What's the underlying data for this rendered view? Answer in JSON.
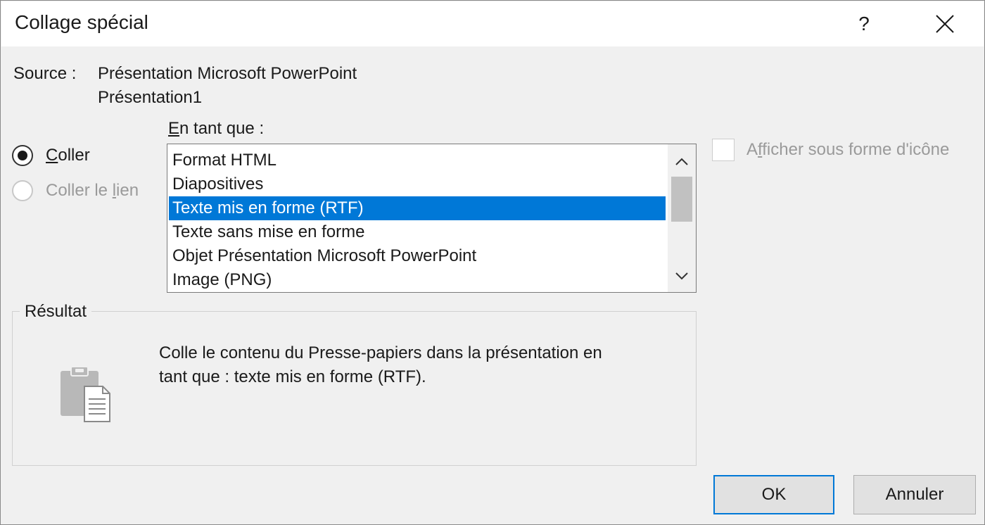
{
  "window": {
    "title": "Collage spécial",
    "help_label": "?"
  },
  "source": {
    "label": "Source :",
    "line1": "Présentation Microsoft PowerPoint",
    "line2": "Présentation1"
  },
  "paste_options": {
    "paste": {
      "accel": "C",
      "rest": "oller",
      "checked": true
    },
    "paste_link": {
      "pre": "Coller le ",
      "accel": "l",
      "rest": "ien",
      "checked": false,
      "disabled": true
    }
  },
  "as_type": {
    "accel": "E",
    "rest": "n tant que :",
    "items": [
      {
        "label": "Format HTML",
        "selected": false
      },
      {
        "label": "Diapositives",
        "selected": false
      },
      {
        "label": "Texte mis en forme (RTF)",
        "selected": true
      },
      {
        "label": "Texte sans mise en forme",
        "selected": false
      },
      {
        "label": "Objet Présentation Microsoft PowerPoint",
        "selected": false
      },
      {
        "label": "Image (PNG)",
        "selected": false
      }
    ]
  },
  "display_as_icon": {
    "pre": "A",
    "accel": "f",
    "rest": "ficher sous forme d'icône",
    "checked": false,
    "disabled": true
  },
  "result": {
    "legend": "Résultat",
    "line1": "Colle le contenu du Presse-papiers dans la présentation en",
    "line2": "tant que : texte mis en forme (RTF)."
  },
  "buttons": {
    "ok": "OK",
    "cancel": "Annuler"
  },
  "colors": {
    "accent": "#0078d7",
    "dialog_bg": "#f0f0f0",
    "disabled_text": "#9a9a9a"
  },
  "icons": {
    "close": "close-icon",
    "scroll_up": "chevron-up-icon",
    "scroll_down": "chevron-down-icon",
    "result": "clipboard-paste-icon"
  }
}
